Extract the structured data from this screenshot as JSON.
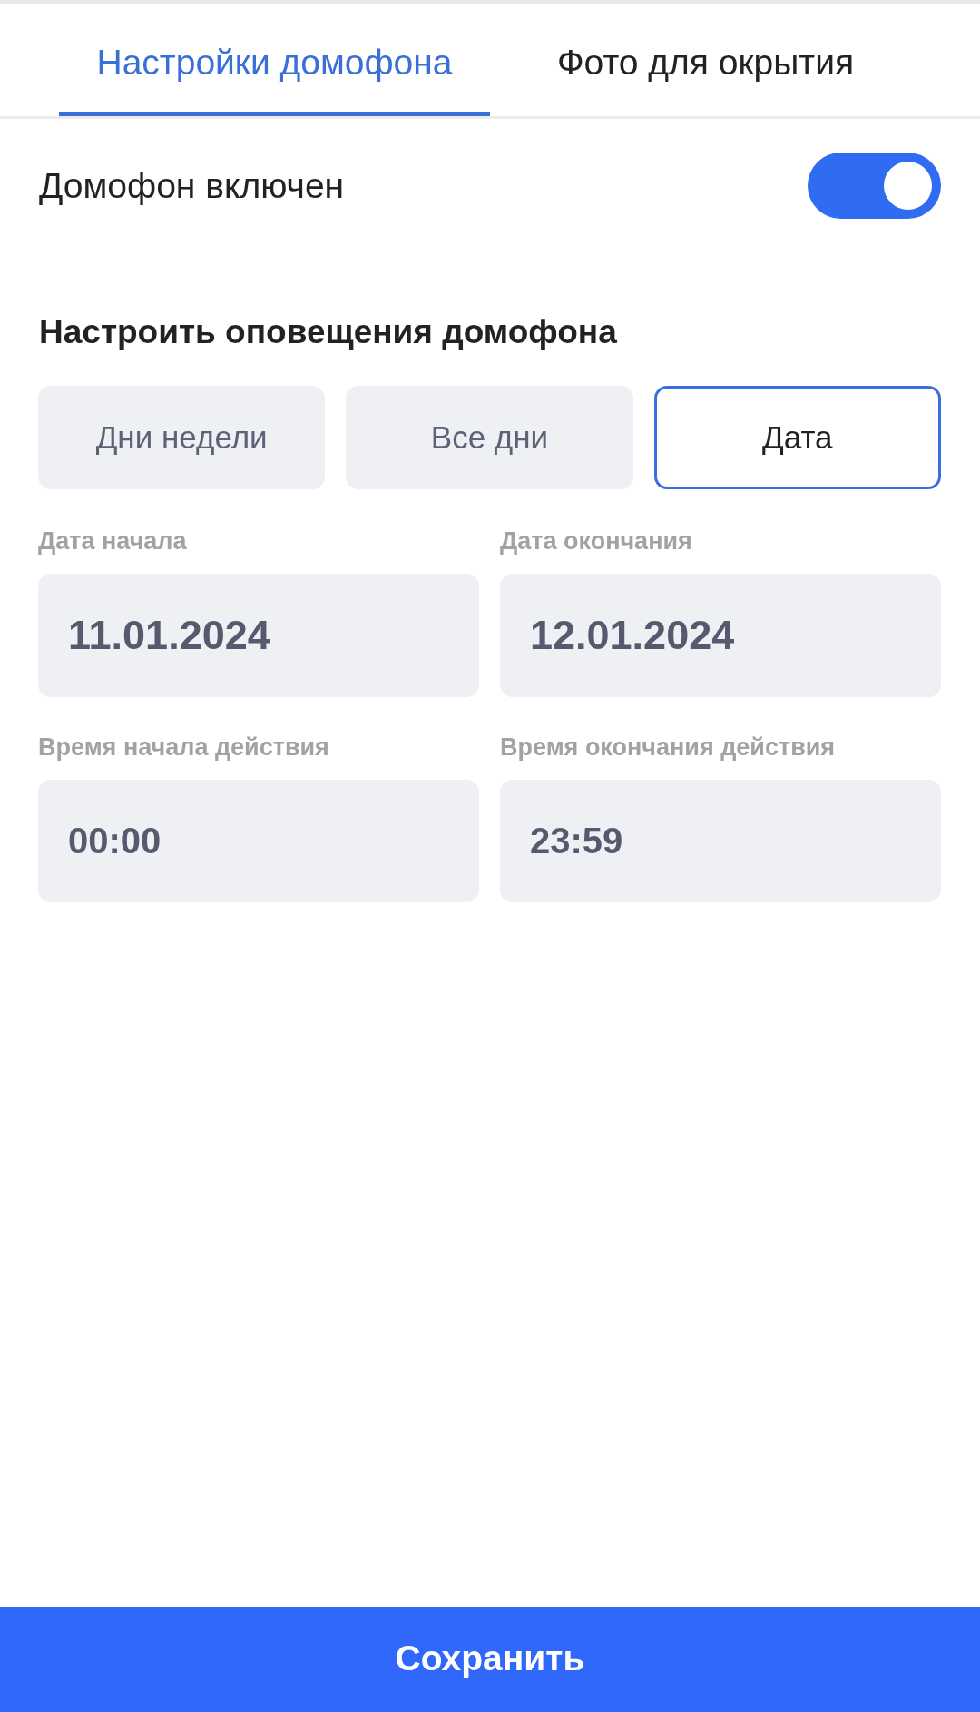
{
  "tabs": [
    {
      "label": "Настройки домофона",
      "selected": true
    },
    {
      "label": "Фото для окрытия",
      "selected": false
    }
  ],
  "intercom_toggle": {
    "label": "Домофон включен",
    "on": true
  },
  "notifications": {
    "title": "Настроить оповещения домофона",
    "modes": [
      {
        "label": "Дни недели",
        "selected": false
      },
      {
        "label": "Все дни",
        "selected": false
      },
      {
        "label": "Дата",
        "selected": true
      }
    ],
    "fields": [
      {
        "kind": "date",
        "label": "Дата начала",
        "value": "11.01.2024"
      },
      {
        "kind": "date",
        "label": "Дата окончания",
        "value": "12.01.2024"
      },
      {
        "kind": "time",
        "label": "Время начала действия",
        "value": "00:00"
      },
      {
        "kind": "time",
        "label": "Время окончания действия",
        "value": "23:59"
      }
    ]
  },
  "save_button": {
    "label": "Сохранить"
  }
}
